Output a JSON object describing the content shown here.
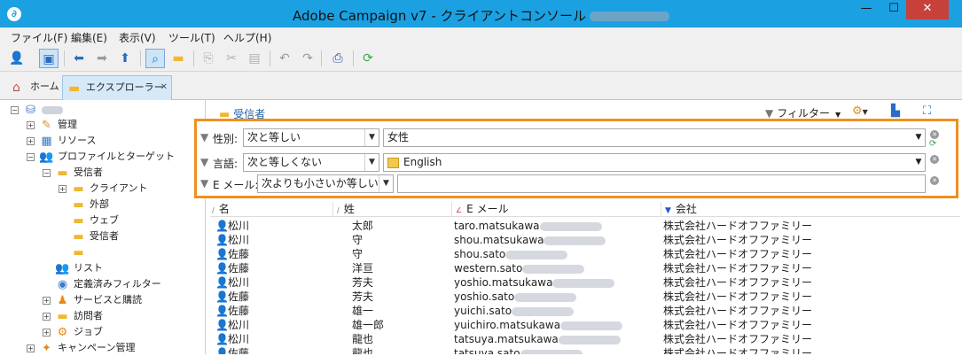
{
  "window": {
    "title": "Adobe Campaign v7 - クライアントコンソール",
    "minimize": "—",
    "maximize": "☐",
    "close": "✕"
  },
  "menu": [
    "ファイル(F)",
    "編集(E)",
    "表示(V)",
    "ツール(T)",
    "ヘルプ(H)"
  ],
  "tabs": {
    "home": "ホーム",
    "explorer": "エクスプローラー"
  },
  "tree": {
    "admin": "管理",
    "resources": "リソース",
    "profiles": "プロファイルとターゲット",
    "recipients": "受信者",
    "client": "クライアント",
    "external": "外部",
    "web": "ウェブ",
    "recipients_sub": "受信者",
    "list": "リスト",
    "predefined_filters": "定義済みフィルター",
    "services": "サービスと購読",
    "visitors": "訪問者",
    "jobs": "ジョブ",
    "campaign": "キャンペーン管理"
  },
  "panel": {
    "title": "受信者",
    "filter_button": "フィルター"
  },
  "filters": [
    {
      "label": "性別:",
      "operator": "次と等しい",
      "value": "女性"
    },
    {
      "label": "言語:",
      "operator": "次と等しくない",
      "value": "English"
    },
    {
      "label": "E メール:",
      "operator": "次よりも小さいか等しい",
      "value": ""
    }
  ],
  "table": {
    "columns": [
      "名",
      "姓",
      "E メール",
      "会社"
    ],
    "rows": [
      {
        "last": "松川",
        "first": "太郎",
        "email": "taro.matsukawa",
        "company": "株式会社ハードオフファミリー"
      },
      {
        "last": "松川",
        "first": "守",
        "email": "shou.matsukawa",
        "company": "株式会社ハードオフファミリー"
      },
      {
        "last": "佐藤",
        "first": "守",
        "email": "shou.sato",
        "company": "株式会社ハードオフファミリー"
      },
      {
        "last": "佐藤",
        "first": "洋亘",
        "email": "western.sato",
        "company": "株式会社ハードオフファミリー"
      },
      {
        "last": "松川",
        "first": "芳夫",
        "email": "yoshio.matsukawa",
        "company": "株式会社ハードオフファミリー"
      },
      {
        "last": "佐藤",
        "first": "芳夫",
        "email": "yoshio.sato",
        "company": "株式会社ハードオフファミリー"
      },
      {
        "last": "佐藤",
        "first": "雄一",
        "email": "yuichi.sato",
        "company": "株式会社ハードオフファミリー"
      },
      {
        "last": "松川",
        "first": "雄一郎",
        "email": "yuichiro.matsukawa",
        "company": "株式会社ハードオフファミリー"
      },
      {
        "last": "松川",
        "first": "龍也",
        "email": "tatsuya.matsukawa",
        "company": "株式会社ハードオフファミリー"
      },
      {
        "last": "佐藤",
        "first": "龍也",
        "email": "tatsuya.sato",
        "company": "株式会社ハードオフファミリー"
      }
    ]
  },
  "colors": {
    "titlebar": "#1ba1e2",
    "highlight": "#f0901e",
    "link": "#1a5fa8"
  }
}
